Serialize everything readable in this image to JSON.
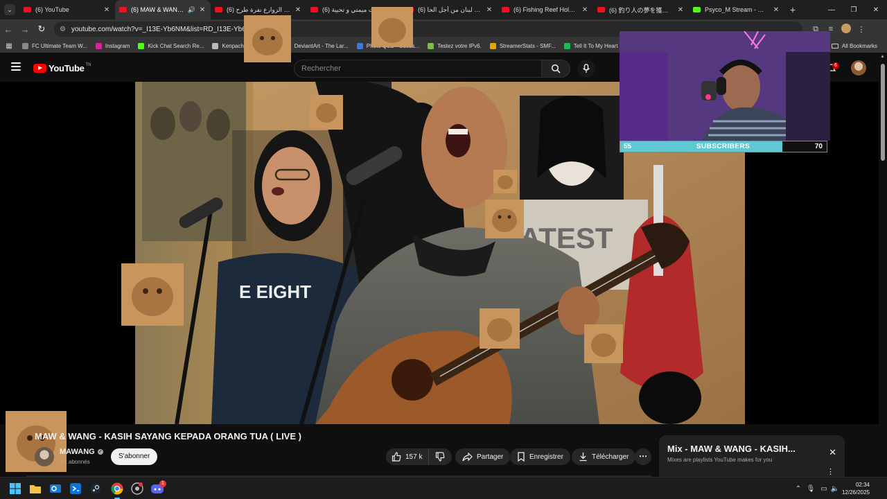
{
  "browser": {
    "tabs": [
      {
        "title": "(6) YouTube",
        "icon": "youtube-favicon",
        "active": false
      },
      {
        "title": "(6) MAW & WANG - K",
        "icon": "youtube-favicon",
        "active": true,
        "audio": true
      },
      {
        "title": "(6) شط الزوارع نفرة طرح ...",
        "icon": "youtube-favicon",
        "active": false
      },
      {
        "title": "(6) باش جيت ميمتي و تحيية...",
        "icon": "youtube-favicon",
        "active": false
      },
      {
        "title": "(6) دخلت لبنان من أجل الحا...",
        "icon": "youtube-favicon",
        "active": false
      },
      {
        "title": "(6) Fishing Reef Holes LO",
        "icon": "youtube-favicon",
        "active": false
      },
      {
        "title": "(6) 釣り人の夢を獲った！禁",
        "icon": "youtube-favicon",
        "active": false
      },
      {
        "title": "Psyco_M Stream - Watch",
        "icon": "kick-favicon",
        "active": false
      }
    ],
    "new_tab": "+",
    "window_controls": {
      "minimize": "—",
      "restore": "❐",
      "close": "✕"
    },
    "url": "youtube.com/watch?v=_I13E-Yb6NM&list=RD_I13E-Yb6NM",
    "bookmarks": [
      {
        "label": "FC Ultimate Team W...",
        "color": "#888888"
      },
      {
        "label": "Instagram",
        "color": "#d6249f"
      },
      {
        "label": "Kick Chat Search Re...",
        "color": "#53fc18"
      },
      {
        "label": "Kenpachi Zaraki Ble...",
        "color": "#bbbbbb"
      },
      {
        "label": "DeviantArt - The Lar...",
        "color": "#05cc47"
      },
      {
        "label": "Photo Quiz - Guess...",
        "color": "#3a7bd5"
      },
      {
        "label": "Testez votre IPv6.",
        "color": "#7cbf42"
      },
      {
        "label": "StreamerStats - SMF...",
        "color": "#e5a50a"
      },
      {
        "label": "Tell It To My Heart -...",
        "color": "#1db954"
      }
    ],
    "all_bookmarks": "All Bookmarks"
  },
  "youtube": {
    "logo_text": "YouTube",
    "logo_suffix": "TN",
    "search_placeholder": "Rechercher",
    "notification_count": "6",
    "video": {
      "title": "MAW & WANG - KASIH SAYANG KEPADA ORANG TUA ( LIVE )",
      "channel": "MAWANG",
      "subscribers": "3 k abonnés",
      "subscribe_label": "S'abonner",
      "likes": "157 k",
      "share_label": "Partager",
      "save_label": "Enregistrer",
      "download_label": "Télécharger"
    },
    "mix": {
      "title": "Mix - MAW & WANG - KASIH...",
      "subtitle": "Mixes are playlists YouTube makes for you"
    }
  },
  "overlay": {
    "current_subs": "55",
    "label": "SUBSCRIBERS",
    "goal": "70",
    "progress": 0.786
  },
  "taskbar": {
    "time": "02:34",
    "date": "12/26/2025",
    "discord_badge": "1"
  },
  "colors": {
    "youtube_red": "#ff0000",
    "overlay_fill": "#5fc8d3",
    "taskbar_accent": "#4cc2ff"
  }
}
